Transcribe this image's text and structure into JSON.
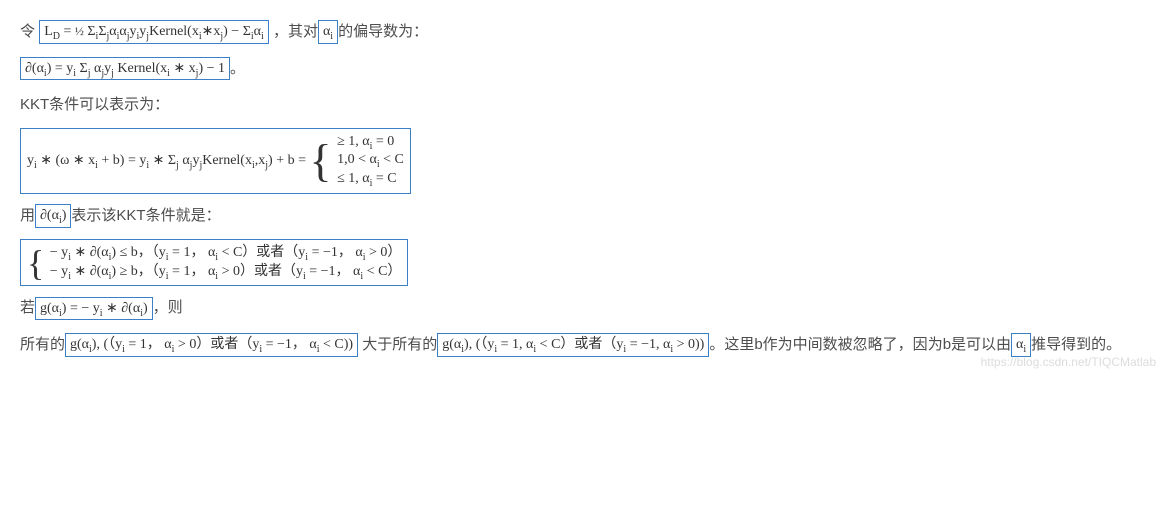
{
  "line1_prefix": "令",
  "formula1": "Lᴅ = ½ ΣᵢΣⱼαᵢαⱼyᵢyⱼKernel(xᵢ∗xⱼ) − Σᵢαᵢ",
  "line1_mid": "，其对",
  "formula1b": "αᵢ",
  "line1_suffix": "的偏导数为：",
  "formula2": "∂(αᵢ) = yᵢ Σⱼ αⱼyⱼ Kernel(xᵢ∗xⱼ) − 1",
  "line2_suffix": "。",
  "line3": "KKT条件可以表示为：",
  "formula3_left": "yᵢ ∗ (ω ∗ xᵢ + b) =  yᵢ ∗ Σⱼ αⱼyⱼKernel(xᵢ,xⱼ) + b =",
  "formula3_brace_l1": "≥ 1, αᵢ = 0",
  "formula3_brace_l2": "1, 0 < αᵢ < C",
  "formula3_brace_l3": "≤ 1, αᵢ = C",
  "line4_prefix": "用",
  "formula4a": "∂(αᵢ)",
  "line4_suffix": "表示该KKT条件就是：",
  "formula5_l1": "− yᵢ ∗ ∂(αᵢ) ≤ b，（yᵢ = 1， αᵢ < C）或者（yᵢ = −1， αᵢ > 0）",
  "formula5_l2": "− yᵢ ∗ ∂(αᵢ) ≥ b，（yᵢ = 1， αᵢ > 0）或者（yᵢ = −1， αᵢ < C）",
  "line5_prefix": "若",
  "formula6": "g(αᵢ) = − yᵢ ∗ ∂(αᵢ)",
  "line5_suffix": "，则",
  "line6_prefix": "所有的",
  "formula7": "g(αᵢ), (（yᵢ = 1， αᵢ > 0）或者（yᵢ = −1， αᵢ < C))",
  "line6_mid": " 大于所有的",
  "formula8": "g(αᵢ), (（yᵢ = 1,  αᵢ < C）或者（yᵢ = −1,  αᵢ > 0))",
  "line6_suffix": "。这里b作为中间数被忽略了，因为b是可以由",
  "formula9": "αᵢ",
  "line6_end": "推导得到的。",
  "watermark": "https://blog.csdn.net/TIQCMatlab"
}
